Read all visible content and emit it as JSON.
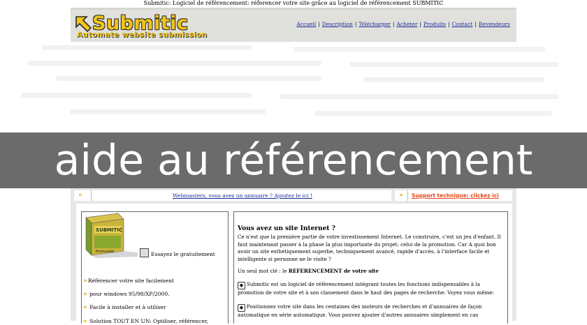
{
  "page": {
    "title": "Submitic: Logiciel de référencement: réferencer votre site grâce au logiciel de référencement SUBMITIC"
  },
  "header": {
    "logo_text": "Submitic",
    "logo_tagline": "Automate website submission",
    "nav": [
      "Accueil",
      "Description",
      "Télécharger",
      "Acheter",
      "Produits",
      "Contact",
      "Revendeurs"
    ]
  },
  "banner": {
    "text": "aide au référencement"
  },
  "strips": {
    "left_link": "Webmasters, vous avez un annuaire ? Ajoutez le ici !",
    "right_link": "Support technique: clickez ici"
  },
  "product": {
    "box_label": "SUBMITIC",
    "box_sub": "Promoweb",
    "try_label": "Essayez le gratuitement",
    "features": [
      "Référencer votre site facilement",
      "pour windows 95/98/XP/2000.",
      "Facile à installer et à utiliser",
      "Solution TOUT EN UN: Optiliser, référencer,"
    ]
  },
  "article": {
    "heading": "Vous avez un site Internet ?",
    "p1": "Ce n'est que la première partie de votre investissement Internet. Le construire, c'est un jeu d'enfant. Il faut maintenant passer à la phase la plus importante du projet: celui de la promotion. Car A quoi bon avoir un site esthétiquement superbe, techniquement avancé, rapide d'accès, à l'interface facile et intelligente si personne ne le visite ?",
    "p2_prefix": "Un seul mot clé : le ",
    "p2_strong": "REFERENCEMENT de votre site",
    "p3": "Submitic est un logiciel de référencement intégrant toutes les fonctions indispensables à la promotion de votre site et à son classement dans le haut des pages de recherche: Voyez vous même:",
    "p4": "Positionnez votre site dans les centaines des moteurs de recherches et d'annuaires de façon automatique en série automatique. Vous pouvez ajouter d'autres annuaires simplement en cas"
  },
  "colors": {
    "banner_bg": "#6b6b6b",
    "header_bg": "#e0e0dc",
    "link": "#1a2a99",
    "accent_orange": "#e8a317",
    "support_link": "#e34a1a",
    "logo_yellow": "#f0c419"
  }
}
